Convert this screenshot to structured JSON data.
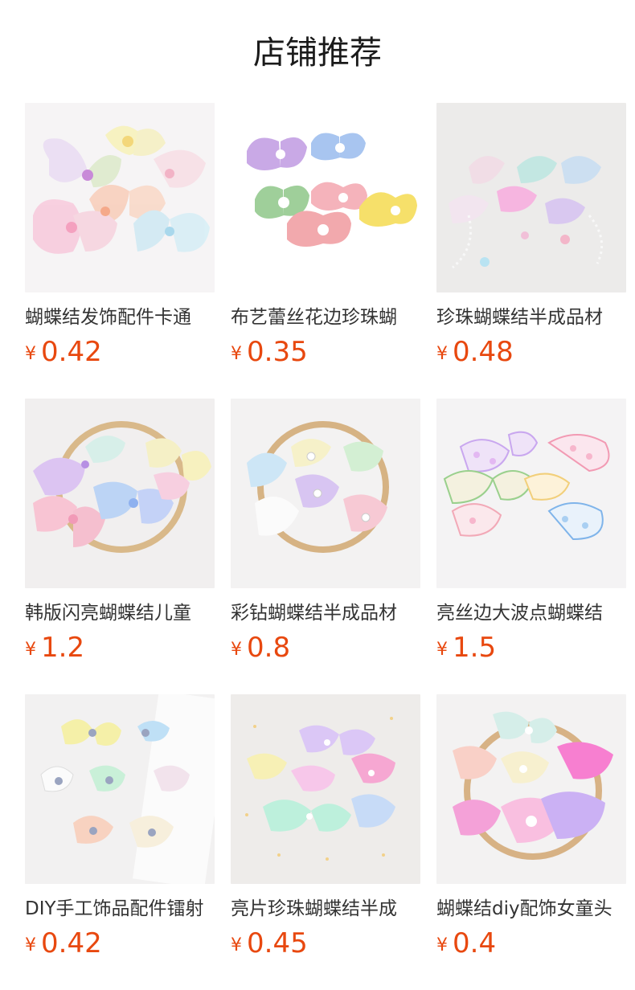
{
  "page": {
    "title": "店铺推荐"
  },
  "colors": {
    "price": "#e8480f",
    "title": "#1a1a1a",
    "name": "#333333"
  },
  "products": [
    {
      "name": "蝴蝶结发饰配件卡通",
      "currency": "¥",
      "price": "0.42",
      "image": "bow-cluster-pastel"
    },
    {
      "name": "布艺蕾丝花边珍珠蝴",
      "currency": "¥",
      "price": "0.35",
      "image": "plaid-pearl-bows"
    },
    {
      "name": "珍珠蝴蝶结半成品材",
      "currency": "¥",
      "price": "0.48",
      "image": "pearl-bows-on-lace"
    },
    {
      "name": "韩版闪亮蝴蝶结儿童",
      "currency": "¥",
      "price": "1.2",
      "image": "sparkle-bows-hoop"
    },
    {
      "name": "彩钻蝴蝶结半成品材",
      "currency": "¥",
      "price": "0.8",
      "image": "rhinestone-bows-hoop"
    },
    {
      "name": "亮丝边大波点蝴蝶结",
      "currency": "¥",
      "price": "1.5",
      "image": "polka-dot-bows"
    },
    {
      "name": "DIY手工饰品配件镭射",
      "currency": "¥",
      "price": "0.42",
      "image": "diy-pearl-bows"
    },
    {
      "name": "亮片珍珠蝴蝶结半成",
      "currency": "¥",
      "price": "0.45",
      "image": "sequin-pearl-bows"
    },
    {
      "name": "蝴蝶结diy配饰女童头",
      "currency": "¥",
      "price": "0.4",
      "image": "ruffle-bows-hoop"
    }
  ]
}
